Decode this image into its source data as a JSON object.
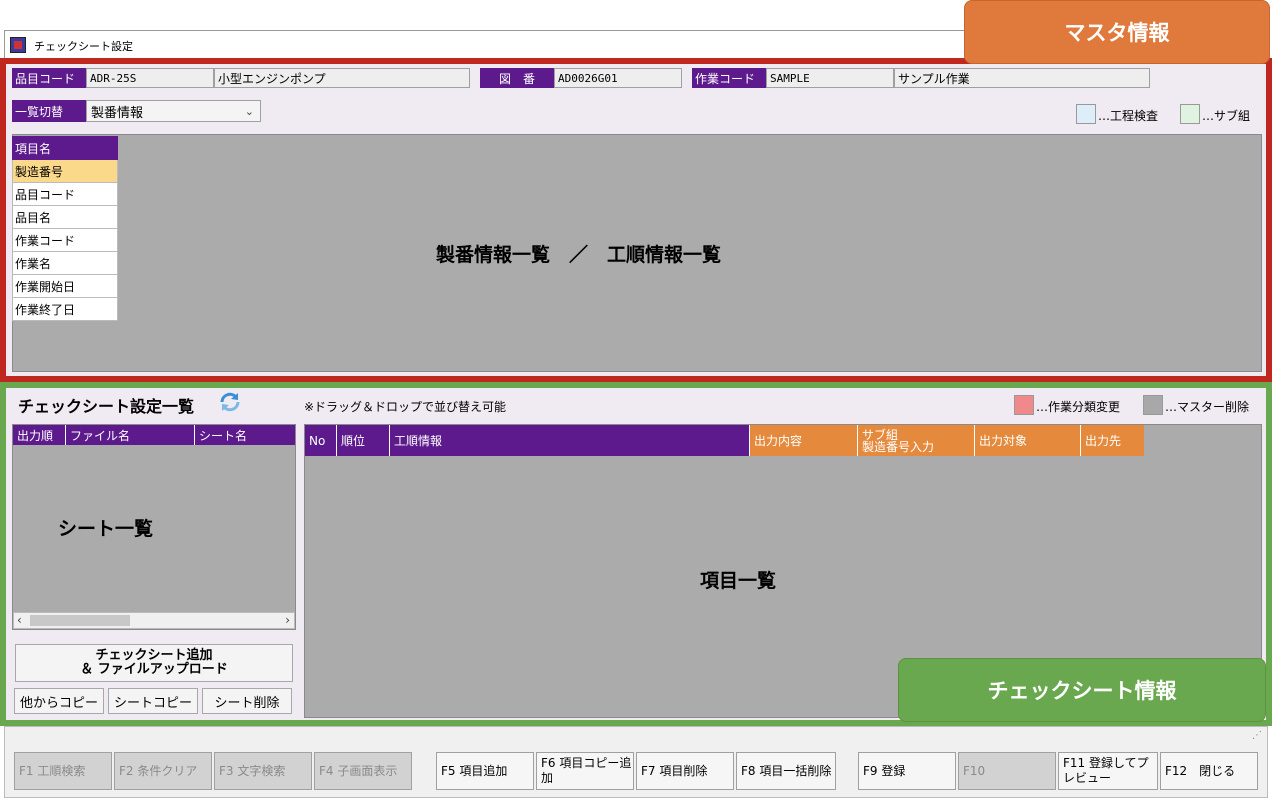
{
  "window": {
    "title": "チェックシート設定"
  },
  "callouts": {
    "master": "マスタ情報",
    "check": "チェックシート情報"
  },
  "master": {
    "item_code": {
      "label": "品目コード",
      "code": "ADR-25S",
      "name": "小型エンジンポンプ"
    },
    "drawing": {
      "label": "図　番",
      "value": "AD0026G01"
    },
    "work_code": {
      "label": "作業コード",
      "code": "SAMPLE",
      "name": "サンプル作業"
    },
    "list_switch": {
      "label": "一覧切替",
      "selected": "製番情報"
    },
    "legend": [
      {
        "color": "#ddeefa",
        "label": "…工程検査"
      },
      {
        "color": "#dff3e0",
        "label": "…サブ組"
      }
    ],
    "item_table": {
      "header": "項目名",
      "rows": [
        "製造番号",
        "品目コード",
        "品目名",
        "作業コード",
        "作業名",
        "作業開始日",
        "作業終了日"
      ]
    },
    "panel_label": "製番情報一覧　／　工順情報一覧"
  },
  "check": {
    "title": "チェックシート設定一覧",
    "drag_note": "※ドラッグ＆ドロップで並び替え可能",
    "legend": [
      {
        "color": "#f08a8a",
        "label": "…作業分類変更"
      },
      {
        "color": "#a8a8a8",
        "label": "…マスター削除"
      }
    ],
    "sheet_columns": [
      "出力順",
      "ファイル名",
      "シート名"
    ],
    "sheet_panel_label": "シート一覧",
    "item_columns": [
      "No",
      "順位",
      "工順情報",
      "出力内容",
      "サブ組\n製造番号入力",
      "出力対象",
      "出力先"
    ],
    "item_panel_label": "項目一覧",
    "buttons": {
      "add_upload": "チェックシート追加\n＆ ファイルアップロード",
      "copy_from_other": "他からコピー",
      "sheet_copy": "シートコピー",
      "sheet_delete": "シート削除"
    }
  },
  "fkeys": [
    {
      "label": "F1 工順検索",
      "enabled": false
    },
    {
      "label": "F2 条件クリア",
      "enabled": false
    },
    {
      "label": "F3 文字検索",
      "enabled": false
    },
    {
      "label": "F4 子画面表示",
      "enabled": false
    },
    {
      "label": "F5 項目追加",
      "enabled": true
    },
    {
      "label": "F6 項目コピー追加",
      "enabled": true
    },
    {
      "label": "F7 項目削除",
      "enabled": true
    },
    {
      "label": "F8 項目一括削除",
      "enabled": true
    },
    {
      "label": "F9 登録",
      "enabled": true
    },
    {
      "label": "F10",
      "enabled": false
    },
    {
      "label": "F11 登録してプレビュー",
      "enabled": true
    },
    {
      "label": "F12　閉じる",
      "enabled": true
    }
  ]
}
